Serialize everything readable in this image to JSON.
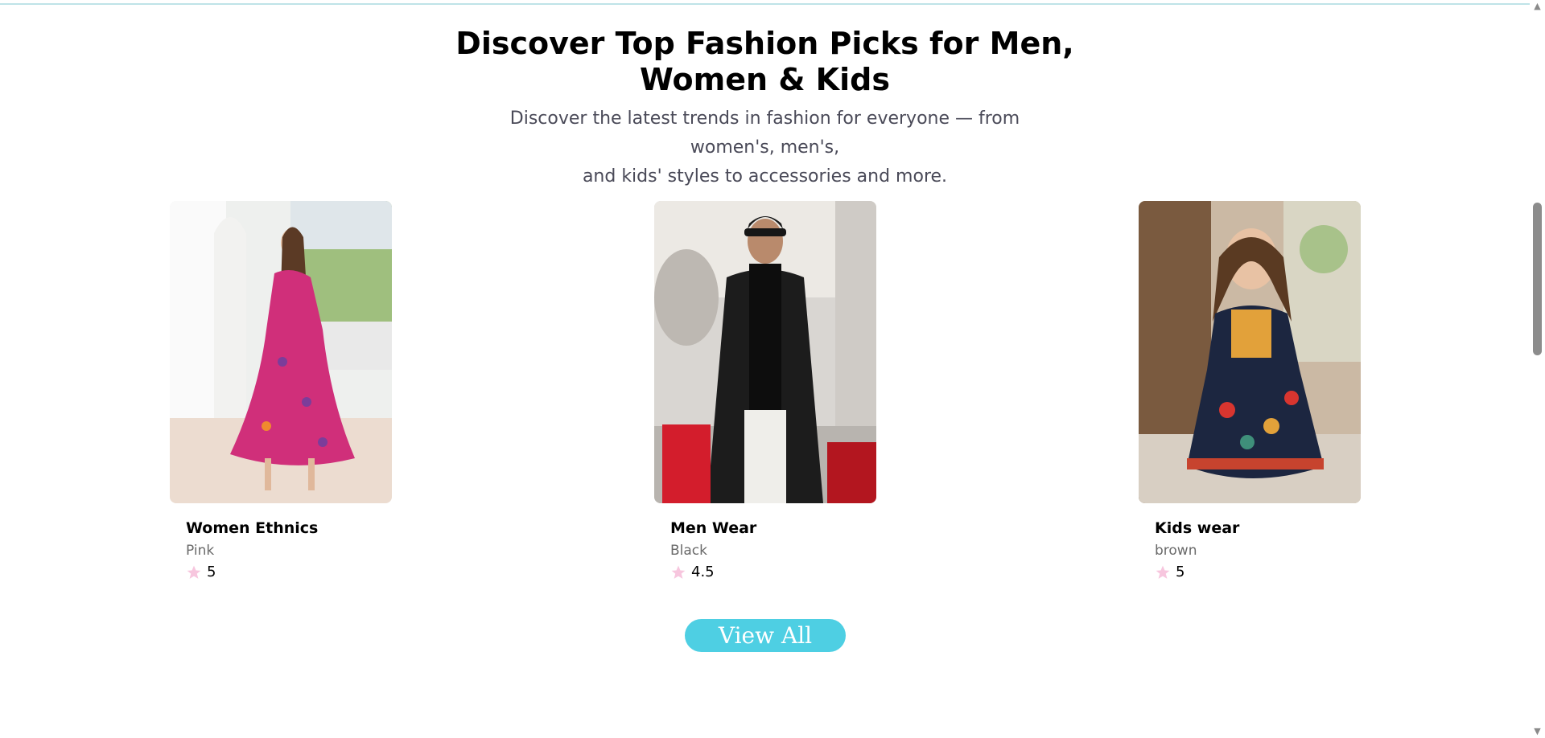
{
  "header": {
    "title_line1": "Discover Top Fashion Picks for Men,",
    "title_line2": "Women & Kids",
    "subtitle_line1": "Discover the latest trends in fashion for everyone — from women's, men's,",
    "subtitle_line2": "and kids' styles to accessories and more."
  },
  "products": [
    {
      "name": "Women Ethnics",
      "color": "Pink",
      "rating": "5"
    },
    {
      "name": "Men Wear",
      "color": "Black",
      "rating": "4.5"
    },
    {
      "name": "Kids wear",
      "color": "brown",
      "rating": "5"
    }
  ],
  "cta": {
    "view_all_label": "View All"
  },
  "colors": {
    "accent": "#4ecfe3",
    "star": "#f7c6de"
  }
}
